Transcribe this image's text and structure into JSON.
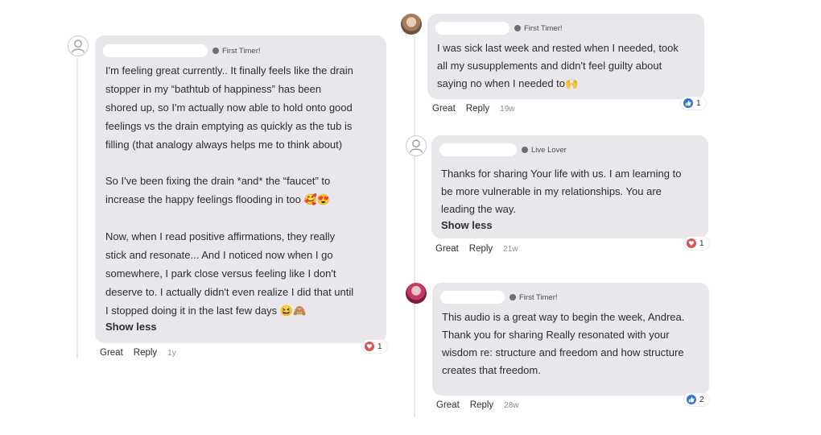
{
  "comments": [
    {
      "badge": "First Timer!",
      "paragraphs": [
        "I'm feeling great currently.. It finally feels like the drain\nstopper in my “bathtub of happiness” has been\nshored up, so I'm actually now able to hold onto good\nfeelings vs the drain emptying as quickly as the tub is\nfilling (that analogy always helps me to think about)",
        "So I've been fixing the drain *and* the “faucet” to\nincrease the happy feelings flooding in too 🥰😍",
        "Now, when I read positive affirmations, they really\nstick and resonate... And I noticed now when I go\nsomewhere, I park close versus feeling like I don't\ndeserve to. I actually didn't even realize I did that until\nI stopped doing it in the last few days 😆🙈"
      ],
      "show_less": "Show less",
      "actions": {
        "great": "Great",
        "reply": "Reply",
        "time": "1y"
      },
      "reaction": {
        "icon": "heart-icon",
        "count": "1"
      }
    },
    {
      "badge": "First Timer!",
      "paragraphs": [
        "I was sick last week and rested when I needed, took\nall my susupplements and didn't feel guilty about\nsaying no when I needed to🙌"
      ],
      "actions": {
        "great": "Great",
        "reply": "Reply",
        "time": "19w"
      },
      "reaction": {
        "icon": "thumbs-up-icon",
        "count": "1"
      }
    },
    {
      "badge": "Live Lover",
      "paragraphs": [
        "Thanks for sharing Your life with us. I am learning to\nbe more vulnerable in my relationships. You are\nleading the way."
      ],
      "show_less": "Show less",
      "actions": {
        "great": "Great",
        "reply": "Reply",
        "time": "21w"
      },
      "reaction": {
        "icon": "heart-icon",
        "count": "1"
      }
    },
    {
      "badge": "First Timer!",
      "paragraphs": [
        "This audio is a great way to begin the week, Andrea.\nThank you for sharing Really resonated with your\nwisdom re: structure and freedom and how structure\ncreates that freedom."
      ],
      "actions": {
        "great": "Great",
        "reply": "Reply",
        "time": "28w"
      },
      "reaction": {
        "icon": "thumbs-up-icon",
        "count": "2"
      }
    }
  ],
  "colors": {
    "bubble": "#e9e6ec",
    "heart": "#d9534f",
    "like": "#2f74d8"
  }
}
